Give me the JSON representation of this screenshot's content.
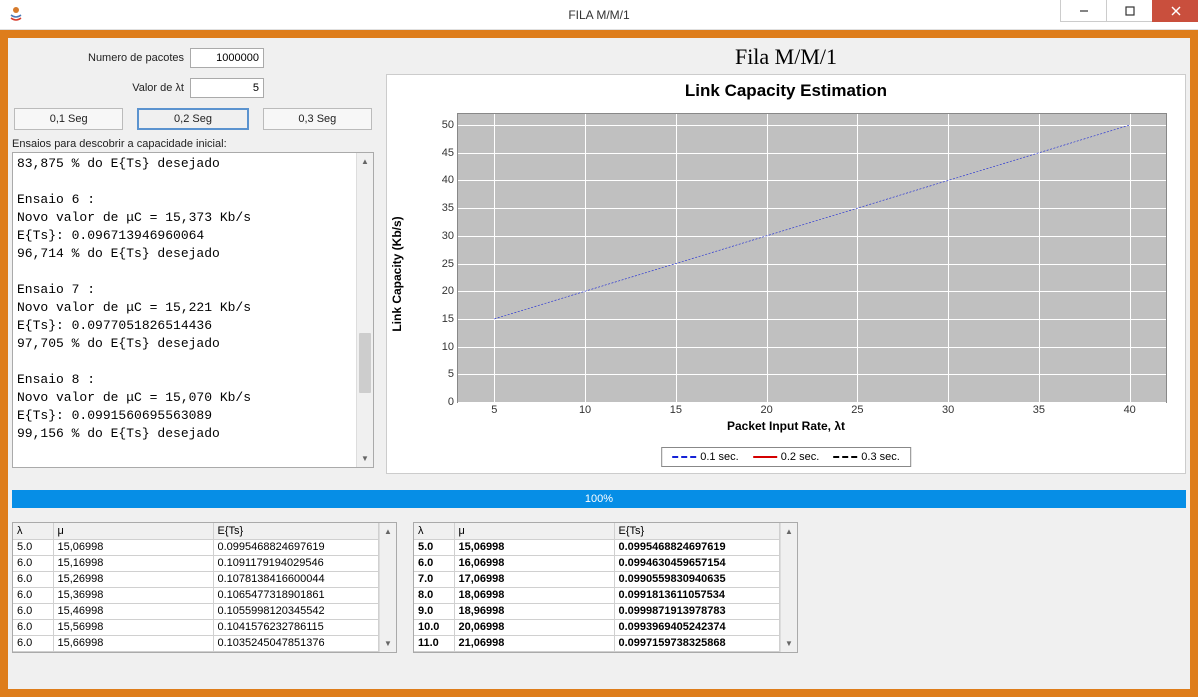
{
  "window": {
    "title": "FILA M/M/1"
  },
  "form": {
    "packets_label": "Numero de pacotes",
    "packets_value": "1000000",
    "lambda_label": "Valor de λt",
    "lambda_value": "5"
  },
  "buttons": {
    "b01": "0,1 Seg",
    "b02": "0,2 Seg",
    "b03": "0,3 Seg"
  },
  "log": {
    "label": "Ensaios para descobrir a capacidade inicial:",
    "text": "83,875 % do E{Ts} desejado\n\nEnsaio 6 :\nNovo valor de μC = 15,373 Kb/s\nE{Ts}: 0.096713946960064\n96,714 % do E{Ts} desejado\n\nEnsaio 7 :\nNovo valor de μC = 15,221 Kb/s\nE{Ts}: 0.0977051826514436\n97,705 % do E{Ts} desejado\n\nEnsaio 8 :\nNovo valor de μC = 15,070 Kb/s\nE{Ts}: 0.0991560695563089\n99,156 % do E{Ts} desejado"
  },
  "chart_header": "Fila M/M/1",
  "chart_data": {
    "type": "line",
    "title": "Link Capacity Estimation",
    "xlabel": "Packet Input Rate, λt",
    "ylabel": "Link Capacity (Kb/s)",
    "xlim": [
      3,
      42
    ],
    "ylim": [
      0,
      52
    ],
    "x_ticks": [
      5,
      10,
      15,
      20,
      25,
      30,
      35,
      40
    ],
    "y_ticks": [
      0,
      5,
      10,
      15,
      20,
      25,
      30,
      35,
      40,
      45,
      50
    ],
    "series": [
      {
        "name": "0.1 sec.",
        "color": "#1522d6",
        "dash": "6,5",
        "x": [
          5,
          40
        ],
        "y": [
          15,
          50
        ]
      },
      {
        "name": "0.2 sec.",
        "color": "#d40000",
        "dash": "none",
        "x": [],
        "y": []
      },
      {
        "name": "0.3 sec.",
        "color": "#000000",
        "dash": "3,3",
        "x": [],
        "y": []
      }
    ]
  },
  "progress": {
    "text": "100%"
  },
  "table1": {
    "headers": [
      "λ",
      "μ",
      "E{Ts}"
    ],
    "col_widths": [
      "40px",
      "160px",
      "auto"
    ],
    "rows": [
      [
        "5.0",
        "15,06998",
        "0.0995468824697619"
      ],
      [
        "6.0",
        "15,16998",
        "0.1091179194029546"
      ],
      [
        "6.0",
        "15,26998",
        "0.1078138416600044"
      ],
      [
        "6.0",
        "15,36998",
        "0.1065477318901861"
      ],
      [
        "6.0",
        "15,46998",
        "0.1055998120345542"
      ],
      [
        "6.0",
        "15,56998",
        "0.1041576232786115"
      ],
      [
        "6.0",
        "15,66998",
        "0.1035245047851376"
      ]
    ]
  },
  "table2": {
    "headers": [
      "λ",
      "μ",
      "E{Ts}"
    ],
    "col_widths": [
      "40px",
      "160px",
      "auto"
    ],
    "rows": [
      [
        "5.0",
        "15,06998",
        "0.0995468824697619"
      ],
      [
        "6.0",
        "16,06998",
        "0.0994630459657154"
      ],
      [
        "7.0",
        "17,06998",
        "0.0990559830940635"
      ],
      [
        "8.0",
        "18,06998",
        "0.0991813611057534"
      ],
      [
        "9.0",
        "18,96998",
        "0.0999871913978783"
      ],
      [
        "10.0",
        "20,06998",
        "0.0993969405242374"
      ],
      [
        "11.0",
        "21,06998",
        "0.0997159738325868"
      ]
    ]
  }
}
